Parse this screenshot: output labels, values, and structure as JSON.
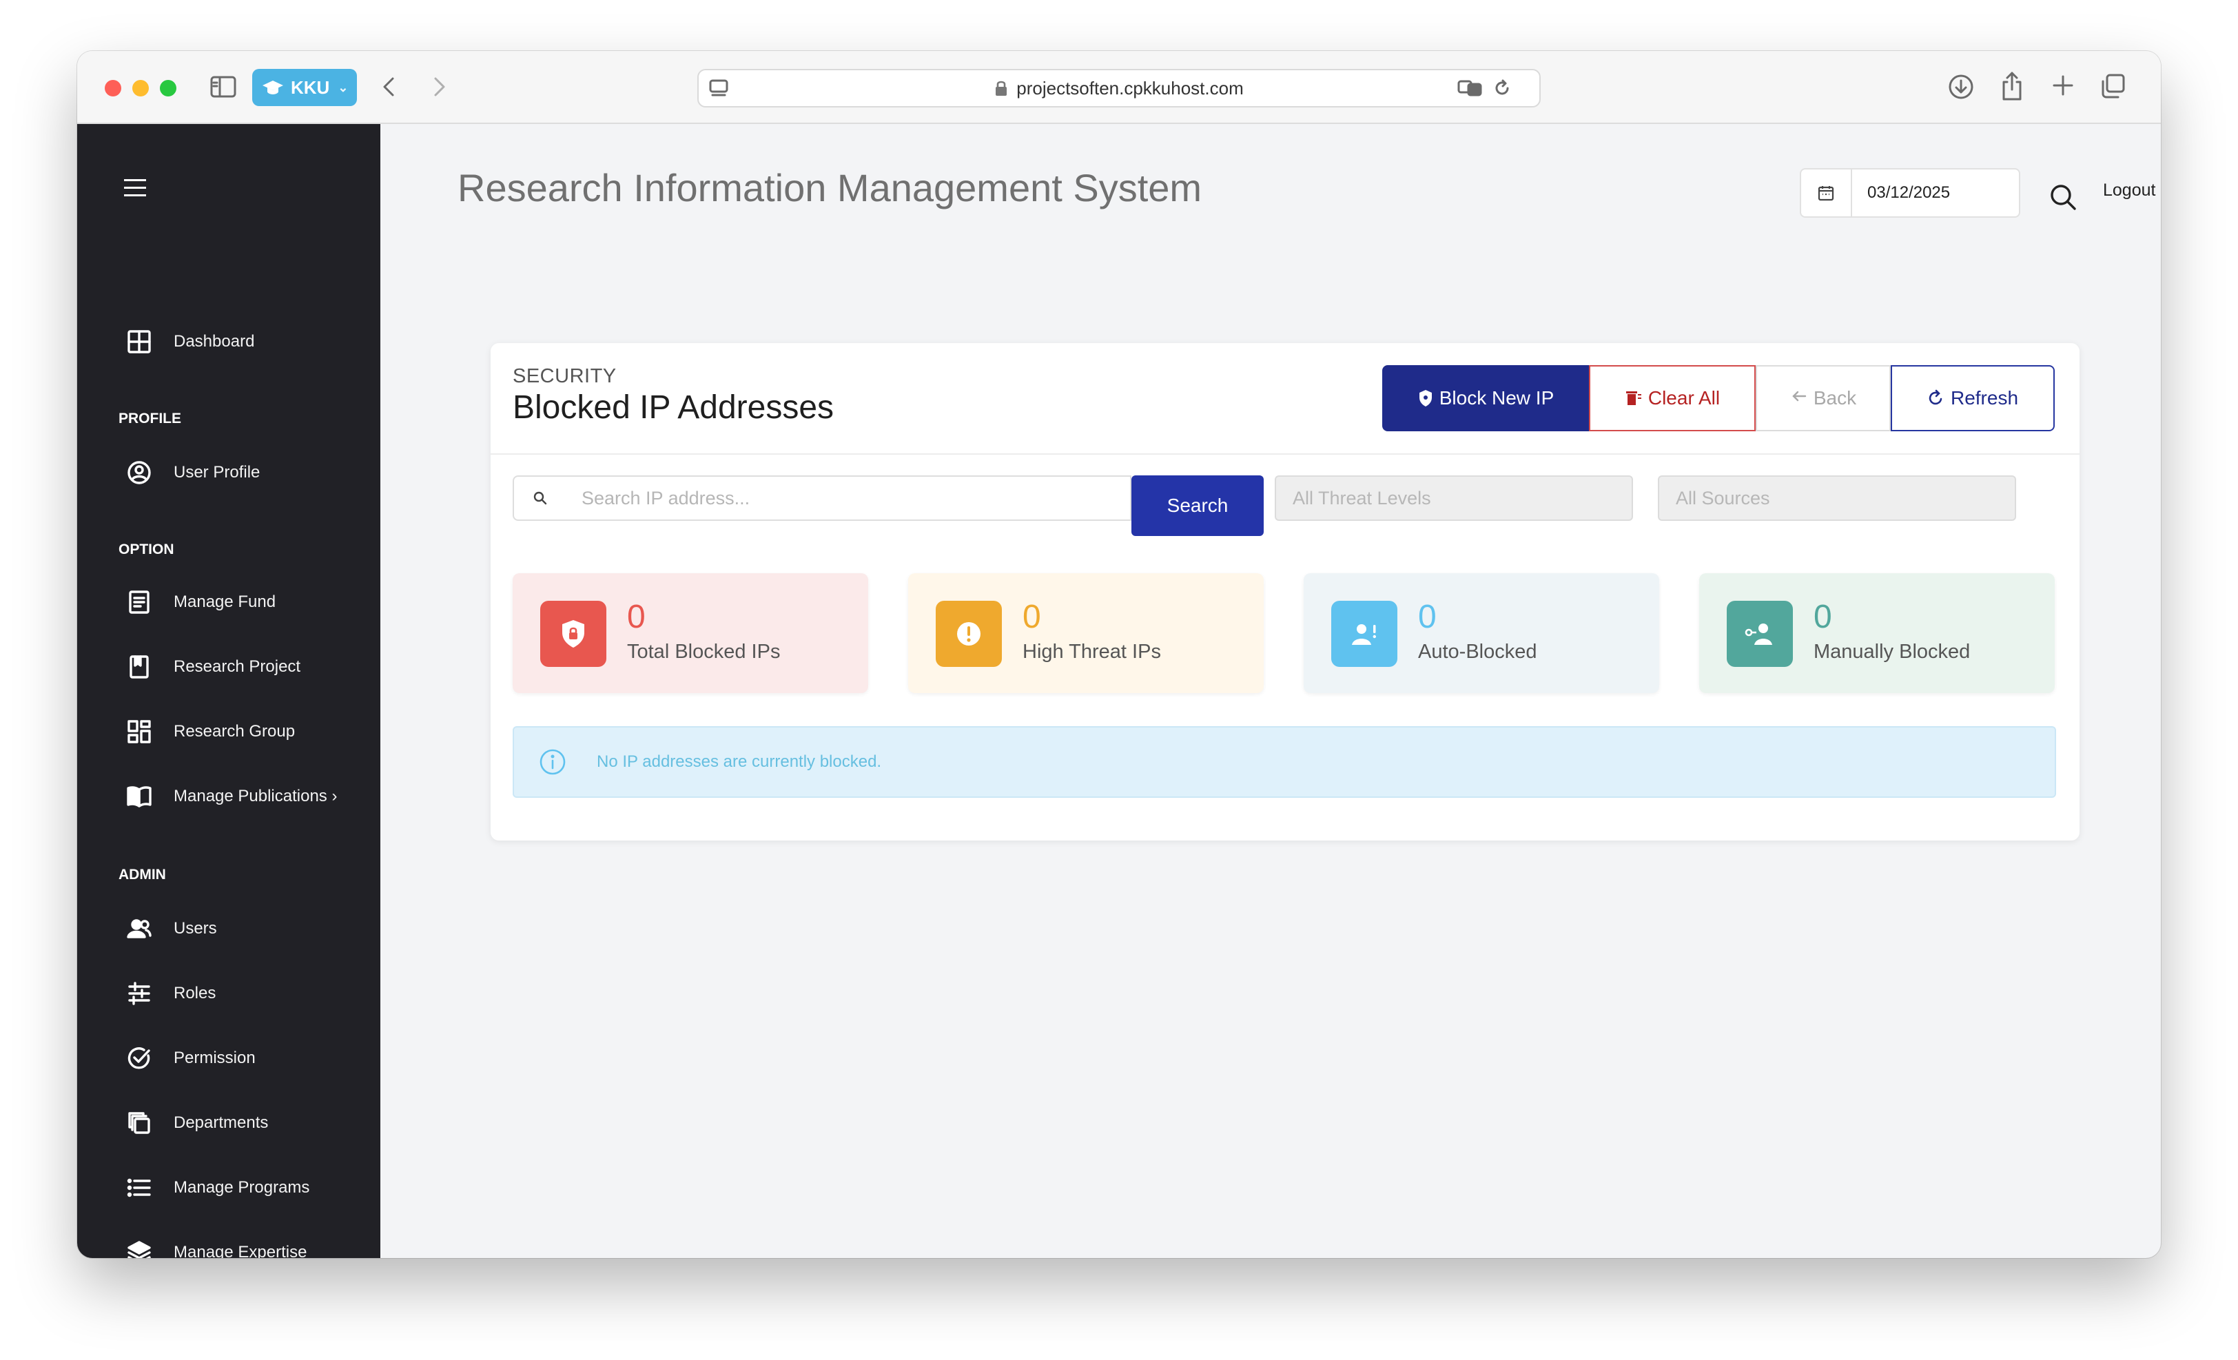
{
  "browser": {
    "profile_label": "KKU",
    "url": "projectsoften.cpkkuhost.com"
  },
  "sidebar": {
    "items": [
      {
        "label": "Dashboard",
        "icon": "dashboard-icon"
      },
      {
        "label": "User Profile",
        "icon": "user-circle-icon"
      },
      {
        "label": "Manage Fund",
        "icon": "document-icon"
      },
      {
        "label": "Research Project",
        "icon": "bookmark-icon"
      },
      {
        "label": "Research Group",
        "icon": "grid-icon"
      },
      {
        "label": "Manage Publications ›",
        "icon": "book-open-icon"
      },
      {
        "label": "Users",
        "icon": "users-icon"
      },
      {
        "label": "Roles",
        "icon": "sliders-icon"
      },
      {
        "label": "Permission",
        "icon": "check-circle-icon"
      },
      {
        "label": "Departments",
        "icon": "copy-icon"
      },
      {
        "label": "Manage Programs",
        "icon": "list-icon"
      },
      {
        "label": "Manage Expertise",
        "icon": "layers-icon"
      }
    ],
    "sections": {
      "profile": "PROFILE",
      "option": "OPTION",
      "admin": "ADMIN"
    }
  },
  "header": {
    "title": "Research Information Management System",
    "date": "03/12/2025",
    "logout": "Logout"
  },
  "card": {
    "overline": "SECURITY",
    "title": "Blocked IP Addresses",
    "buttons": {
      "block": "Block New IP",
      "clear": "Clear All",
      "back": "Back",
      "refresh": "Refresh"
    },
    "search": {
      "placeholder": "Search IP address...",
      "button": "Search"
    },
    "filters": {
      "threat": "All Threat Levels",
      "source": "All Sources"
    },
    "stats": [
      {
        "value": "0",
        "label": "Total Blocked IPs",
        "color": "#e8574f",
        "bg": "#fbeaea"
      },
      {
        "value": "0",
        "label": "High Threat IPs",
        "color": "#efa92e",
        "bg": "#fff7ea"
      },
      {
        "value": "0",
        "label": "Auto-Blocked",
        "color": "#5fc2ef",
        "bg": "#eef4f7"
      },
      {
        "value": "0",
        "label": "Manually Blocked",
        "color": "#52a79c",
        "bg": "#eaf4ee"
      }
    ],
    "info": "No IP addresses are currently blocked."
  }
}
